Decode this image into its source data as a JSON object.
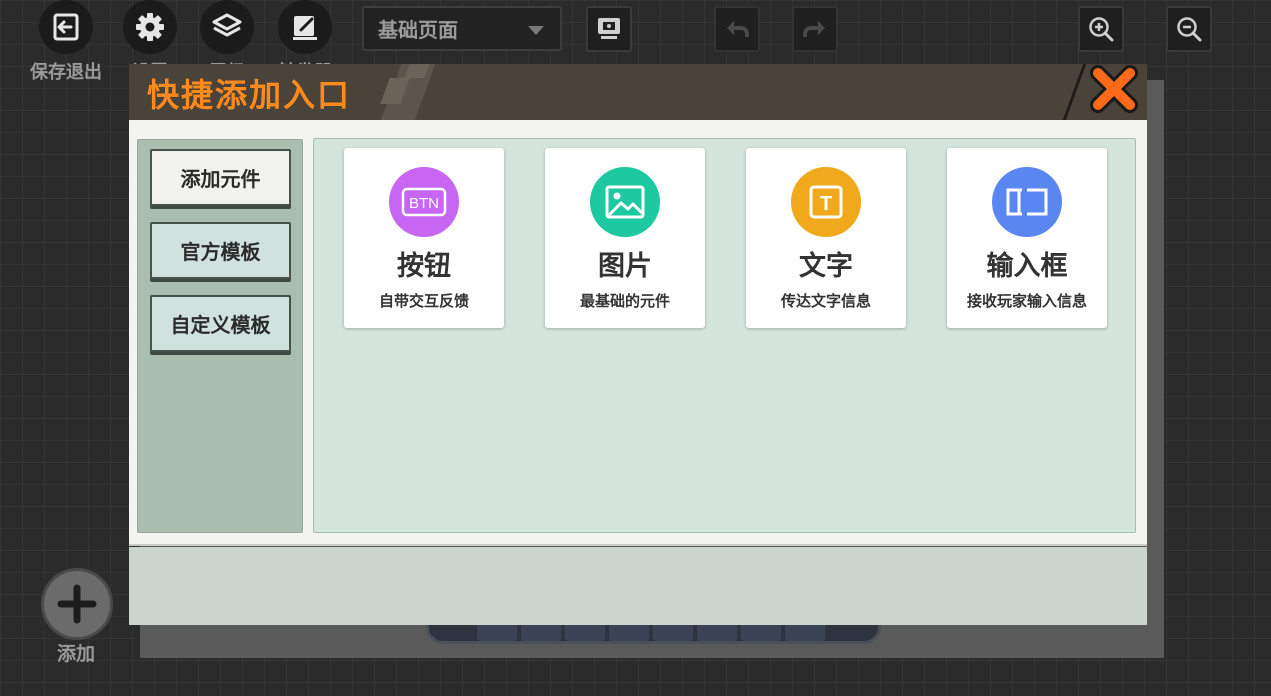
{
  "toolbar": {
    "save_exit_label": "保存退出",
    "settings_label": "设置",
    "layers_label": "层级",
    "triggers_label": "触发器",
    "page_select_value": "基础页面"
  },
  "add_button": {
    "label": "添加"
  },
  "modal": {
    "title": "快捷添加入口",
    "tabs": [
      {
        "label": "添加元件",
        "active": true
      },
      {
        "label": "官方模板",
        "active": false
      },
      {
        "label": "自定义模板",
        "active": false
      }
    ],
    "cards": [
      {
        "icon": "btn-icon",
        "color": "#c766f3",
        "title": "按钮",
        "desc": "自带交互反馈"
      },
      {
        "icon": "image-icon",
        "color": "#1cc9a0",
        "title": "图片",
        "desc": "最基础的元件"
      },
      {
        "icon": "text-icon",
        "color": "#f0a81c",
        "title": "文字",
        "desc": "传达文字信息"
      },
      {
        "icon": "input-box-icon",
        "color": "#5a86f2",
        "title": "输入框",
        "desc": "接收玩家输入信息"
      }
    ],
    "btn_icon_text": "BTN",
    "text_icon_text": "T"
  },
  "colors": {
    "accent_orange": "#ff8a1c",
    "header_bg": "#4a433a",
    "panel_green": "#d3e5dc"
  }
}
